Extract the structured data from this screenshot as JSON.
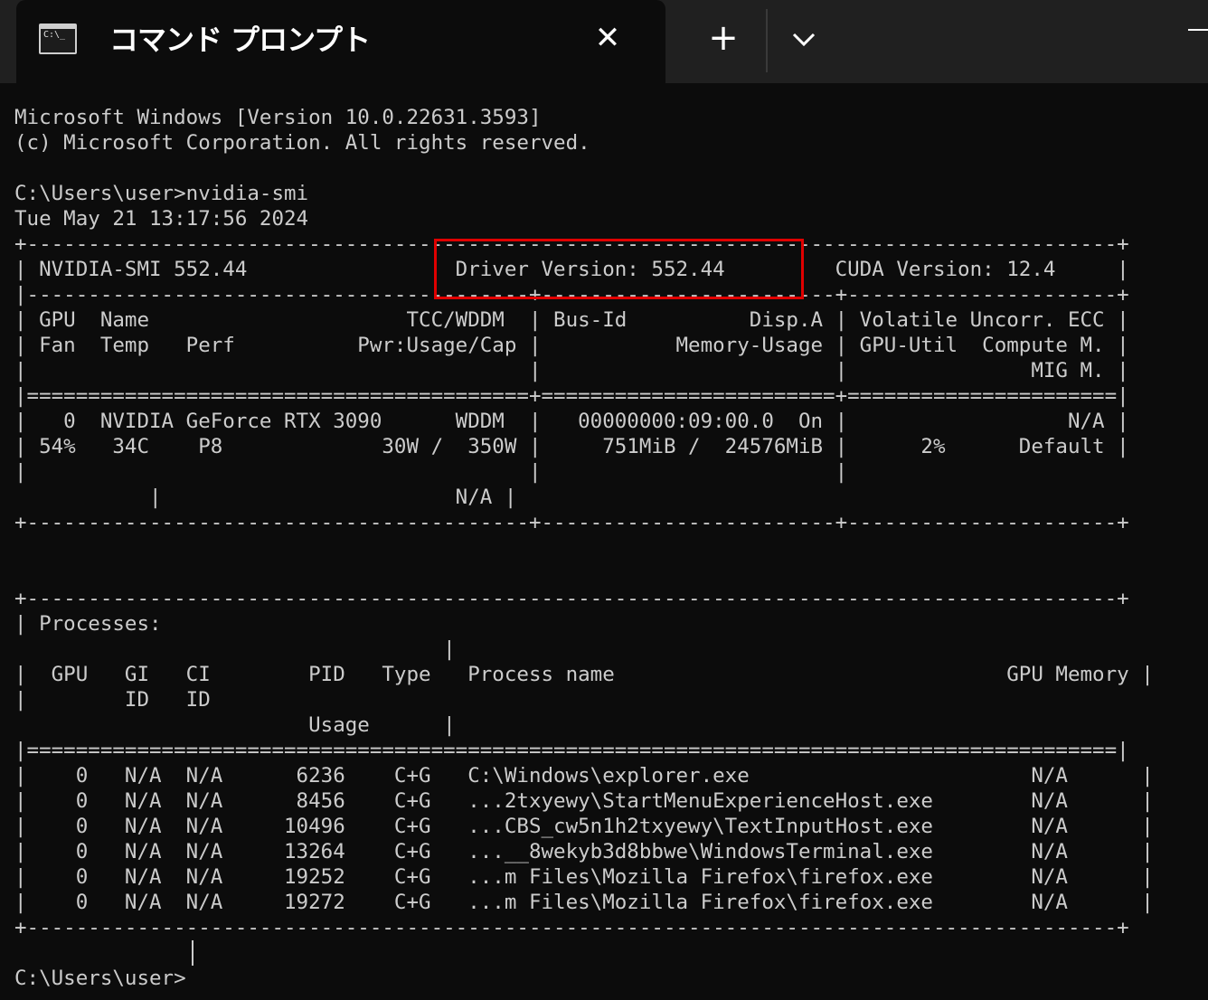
{
  "tab": {
    "title": "コマンド プロンプト",
    "icon_text": "C:\\_",
    "close_symbol": "✕",
    "new_tab_symbol": "+"
  },
  "terminal_lines": [
    "Microsoft Windows [Version 10.0.22631.3593]",
    "(c) Microsoft Corporation. All rights reserved.",
    "",
    "C:\\Users\\user>nvidia-smi",
    "Tue May 21 13:17:56 2024",
    "+-----------------------------------------------------------------------------------------+",
    "| NVIDIA-SMI 552.44                 Driver Version: 552.44         CUDA Version: 12.4     |",
    "|-----------------------------------------+------------------------+----------------------+",
    "| GPU  Name                     TCC/WDDM  | Bus-Id          Disp.A | Volatile Uncorr. ECC |",
    "| Fan  Temp   Perf          Pwr:Usage/Cap |           Memory-Usage | GPU-Util  Compute M. |",
    "|                                         |                        |               MIG M. |",
    "|=========================================+========================+======================|",
    "|   0  NVIDIA GeForce RTX 3090      WDDM  |   00000000:09:00.0  On |                  N/A |",
    "| 54%   34C    P8             30W /  350W |     751MiB /  24576MiB |      2%      Default |",
    "|                                         |                        |",
    "           |                        N/A |",
    "+-----------------------------------------+------------------------+----------------------+",
    "",
    "",
    "+-----------------------------------------------------------------------------------------+",
    "| Processes:",
    "                                   |",
    "|  GPU   GI   CI        PID   Type   Process name                                GPU Memory |",
    "|        ID   ID",
    "                        Usage      |",
    "|=========================================================================================|",
    "|    0   N/A  N/A      6236    C+G   C:\\Windows\\explorer.exe                       N/A      |",
    "|    0   N/A  N/A      8456    C+G   ...2txyewy\\StartMenuExperienceHost.exe        N/A      |",
    "|    0   N/A  N/A     10496    C+G   ...CBS_cw5n1h2txyewy\\TextInputHost.exe        N/A      |",
    "|    0   N/A  N/A     13264    C+G   ...__8wekyb3d8bbwe\\WindowsTerminal.exe        N/A      |",
    "|    0   N/A  N/A     19252    C+G   ...m Files\\Mozilla Firefox\\firefox.exe        N/A      |",
    "|    0   N/A  N/A     19272    C+G   ...m Files\\Mozilla Firefox\\firefox.exe        N/A      |",
    "+-----------------------------------------------------------------------------------------+",
    "",
    "C:\\Users\\user>"
  ],
  "colors": {
    "terminal_bg": "#0c0c0c",
    "titlebar_bg": "#202020",
    "text": "#cccccc",
    "highlight_border": "#e00000"
  }
}
